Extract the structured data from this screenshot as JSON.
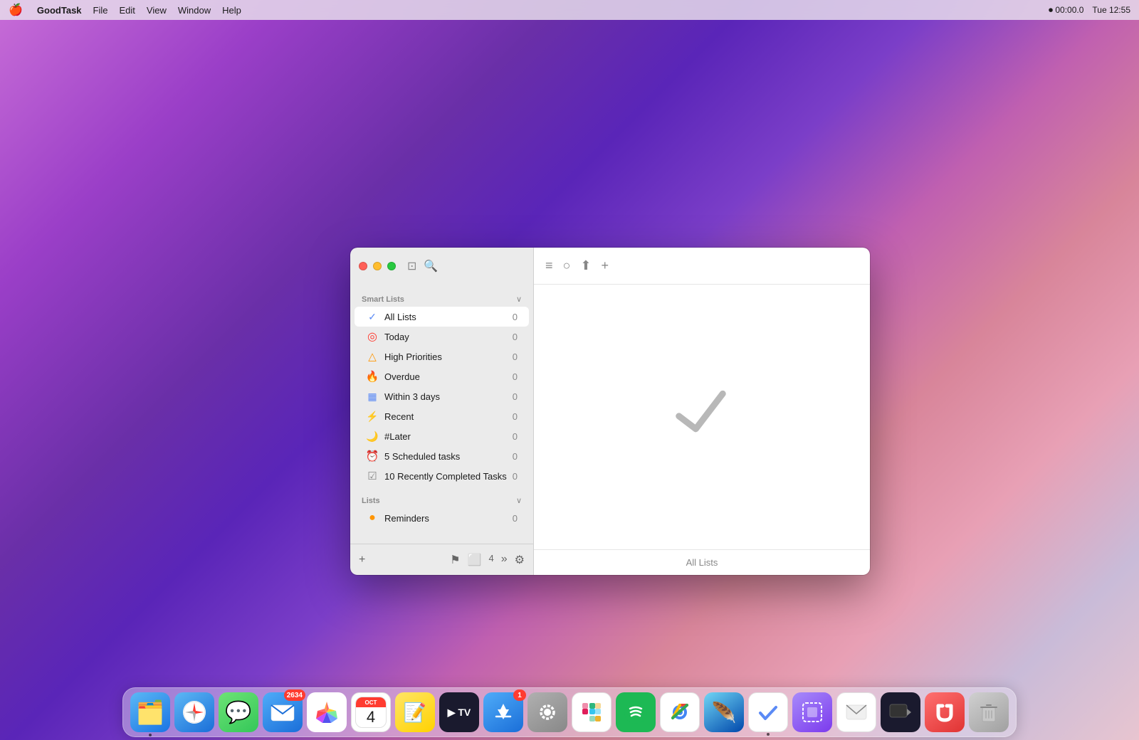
{
  "menubar": {
    "apple": "🍎",
    "app_name": "GoodTask",
    "menus": [
      "File",
      "Edit",
      "View",
      "Window",
      "Help"
    ],
    "right": {
      "recording": "⏺ 00:00.0",
      "time": "Tue 12:55"
    }
  },
  "sidebar": {
    "smart_lists_label": "Smart Lists",
    "lists_label": "Lists",
    "items": [
      {
        "id": "all-lists",
        "icon": "✅",
        "icon_color": "#5b8af5",
        "label": "All Lists",
        "count": "0",
        "active": true
      },
      {
        "id": "today",
        "icon": "⊙",
        "icon_color": "#ff3b30",
        "label": "Today",
        "count": "0",
        "active": false
      },
      {
        "id": "high-priorities",
        "icon": "⚠",
        "icon_color": "#ff9500",
        "label": "High Priorities",
        "count": "0",
        "active": false
      },
      {
        "id": "overdue",
        "icon": "🔥",
        "icon_color": "#ff3b30",
        "label": "Overdue",
        "count": "0",
        "active": false
      },
      {
        "id": "within-3-days",
        "icon": "📅",
        "icon_color": "#5b8af5",
        "label": "Within 3 days",
        "count": "0",
        "active": false
      },
      {
        "id": "recent",
        "icon": "⚡",
        "icon_color": "#5b8af5",
        "label": "Recent",
        "count": "0",
        "active": false
      },
      {
        "id": "later",
        "icon": "🌙",
        "icon_color": "#ff9500",
        "label": "#Later",
        "count": "0",
        "active": false
      },
      {
        "id": "scheduled-tasks",
        "icon": "⏰",
        "icon_color": "#ff3b30",
        "label": "5 Scheduled tasks",
        "count": "0",
        "active": false
      },
      {
        "id": "recently-completed",
        "icon": "☑",
        "icon_color": "#888",
        "label": "10 Recently Completed Tasks",
        "count": "0",
        "active": false
      }
    ],
    "lists": [
      {
        "id": "reminders",
        "icon": "🟠",
        "icon_color": "#ff9500",
        "label": "Reminders",
        "count": "0",
        "active": false
      }
    ],
    "bottom_icons": [
      "+",
      "🚩",
      "⬜",
      "4",
      "»",
      "⚙"
    ]
  },
  "main": {
    "footer_label": "All Lists",
    "toolbar_icons": [
      "≡",
      "○",
      "⬆",
      "+"
    ]
  },
  "dock": {
    "items": [
      {
        "id": "finder",
        "emoji": "🗂",
        "class": "dock-finder",
        "badge": null,
        "dot": true
      },
      {
        "id": "safari",
        "emoji": "🧭",
        "class": "dock-safari",
        "badge": null,
        "dot": false
      },
      {
        "id": "messages",
        "emoji": "💬",
        "class": "dock-messages",
        "badge": null,
        "dot": false
      },
      {
        "id": "mail",
        "emoji": "✉️",
        "class": "dock-mail",
        "badge": "2634",
        "dot": false
      },
      {
        "id": "photos",
        "emoji": "🌸",
        "class": "dock-photos",
        "badge": null,
        "dot": false
      },
      {
        "id": "calendar",
        "emoji": "4",
        "class": "dock-calendar",
        "badge": null,
        "dot": false
      },
      {
        "id": "notes",
        "emoji": "📝",
        "class": "dock-notes",
        "badge": null,
        "dot": false
      },
      {
        "id": "tv",
        "emoji": "▶",
        "class": "dock-tv",
        "badge": null,
        "dot": false
      },
      {
        "id": "appstore",
        "emoji": "🅐",
        "class": "dock-appstore",
        "badge": "1",
        "dot": false
      },
      {
        "id": "settings",
        "emoji": "⚙",
        "class": "dock-settings",
        "badge": null,
        "dot": false
      },
      {
        "id": "slack",
        "emoji": "#",
        "class": "dock-slack",
        "badge": null,
        "dot": false
      },
      {
        "id": "spotify",
        "emoji": "♪",
        "class": "dock-spotify",
        "badge": null,
        "dot": false
      },
      {
        "id": "chrome",
        "emoji": "🌐",
        "class": "dock-chrome",
        "badge": null,
        "dot": false
      },
      {
        "id": "aero",
        "emoji": "✦",
        "class": "dock-aero",
        "badge": null,
        "dot": false
      },
      {
        "id": "goodtask",
        "emoji": "✓",
        "class": "dock-goodtask",
        "badge": null,
        "dot": true
      },
      {
        "id": "screensnap",
        "emoji": "⬛",
        "class": "dock-screensnap",
        "badge": null,
        "dot": false
      },
      {
        "id": "mail2",
        "emoji": "📨",
        "class": "dock-mail2",
        "badge": null,
        "dot": false
      },
      {
        "id": "screen",
        "emoji": "▬",
        "class": "dock-screen",
        "badge": null,
        "dot": false
      },
      {
        "id": "magnet",
        "emoji": "🔴",
        "class": "dock-magnet",
        "badge": null,
        "dot": false
      },
      {
        "id": "trash",
        "emoji": "🗑",
        "class": "dock-trash",
        "badge": null,
        "dot": false
      }
    ]
  }
}
